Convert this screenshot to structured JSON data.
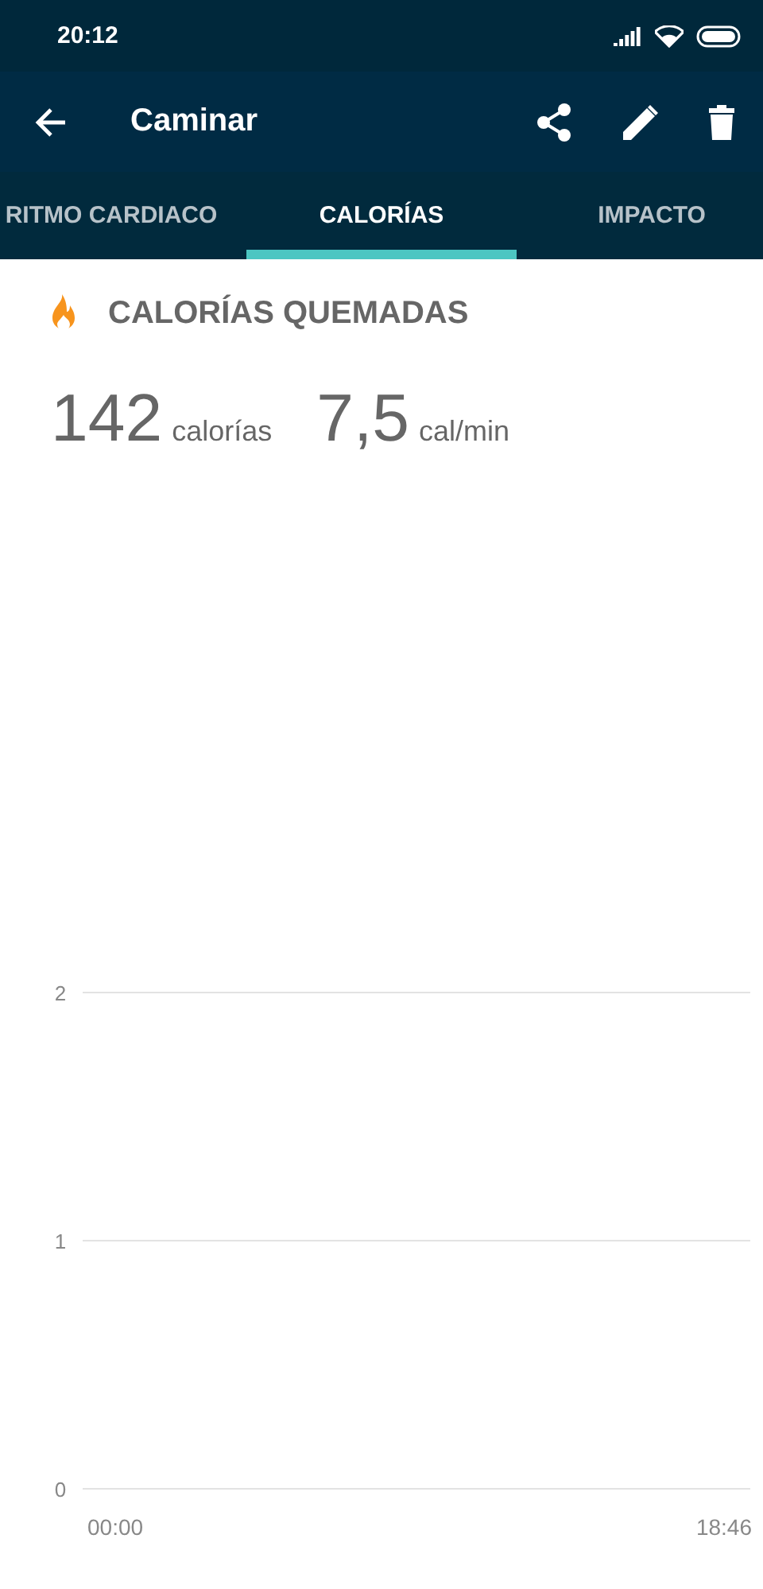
{
  "status_bar": {
    "time": "20:12"
  },
  "app_bar": {
    "title": "Caminar"
  },
  "tabs": [
    {
      "label": "RITMO CARDIACO",
      "selected": false
    },
    {
      "label": "CALORÍAS",
      "selected": true
    },
    {
      "label": "IMPACTO",
      "selected": false
    }
  ],
  "section": {
    "title": "CALORÍAS QUEMADAS"
  },
  "stats": [
    {
      "value": "142",
      "unit": "calorías"
    },
    {
      "value": "7,5",
      "unit": "cal/min"
    }
  ],
  "chart": {
    "y_axis_labels": [
      "2",
      "1",
      "0"
    ],
    "x_axis_labels": [
      "00:00",
      "18:46"
    ]
  }
}
